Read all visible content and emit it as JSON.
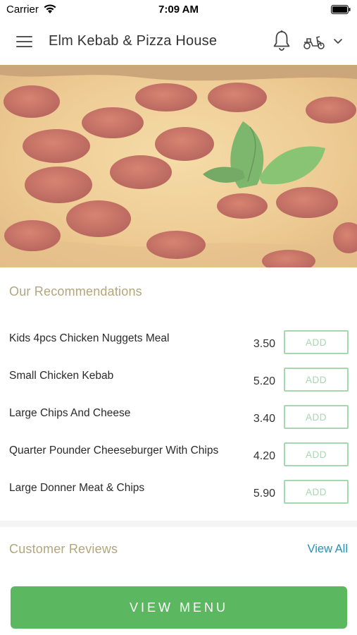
{
  "status_bar": {
    "carrier": "Carrier",
    "time": "7:09 AM"
  },
  "header": {
    "title": "Elm Kebab & Pizza House",
    "icons": [
      "menu-icon",
      "bell-icon",
      "scooter-icon",
      "chevron-down-icon"
    ]
  },
  "hero": {
    "image": "pepperoni-pizza-photo"
  },
  "recommendations": {
    "title": "Our Recommendations",
    "add_label": "ADD",
    "items": [
      {
        "name": "Kids 4pcs Chicken Nuggets Meal",
        "price": "3.50"
      },
      {
        "name": "Small Chicken Kebab",
        "price": "5.20"
      },
      {
        "name": "Large Chips And Cheese",
        "price": "3.40"
      },
      {
        "name": "Quarter Pounder Cheeseburger With Chips",
        "price": "4.20"
      },
      {
        "name": "Large Donner Meat & Chips",
        "price": "5.90"
      }
    ]
  },
  "reviews": {
    "title": "Customer Reviews",
    "view_all_label": "View All"
  },
  "footer": {
    "view_menu_label": "VIEW MENU"
  },
  "colors": {
    "accent_green": "#5cb860",
    "add_border": "#a5d8b0",
    "section_title": "#b3a57c",
    "link_blue": "#2a8fb0"
  }
}
